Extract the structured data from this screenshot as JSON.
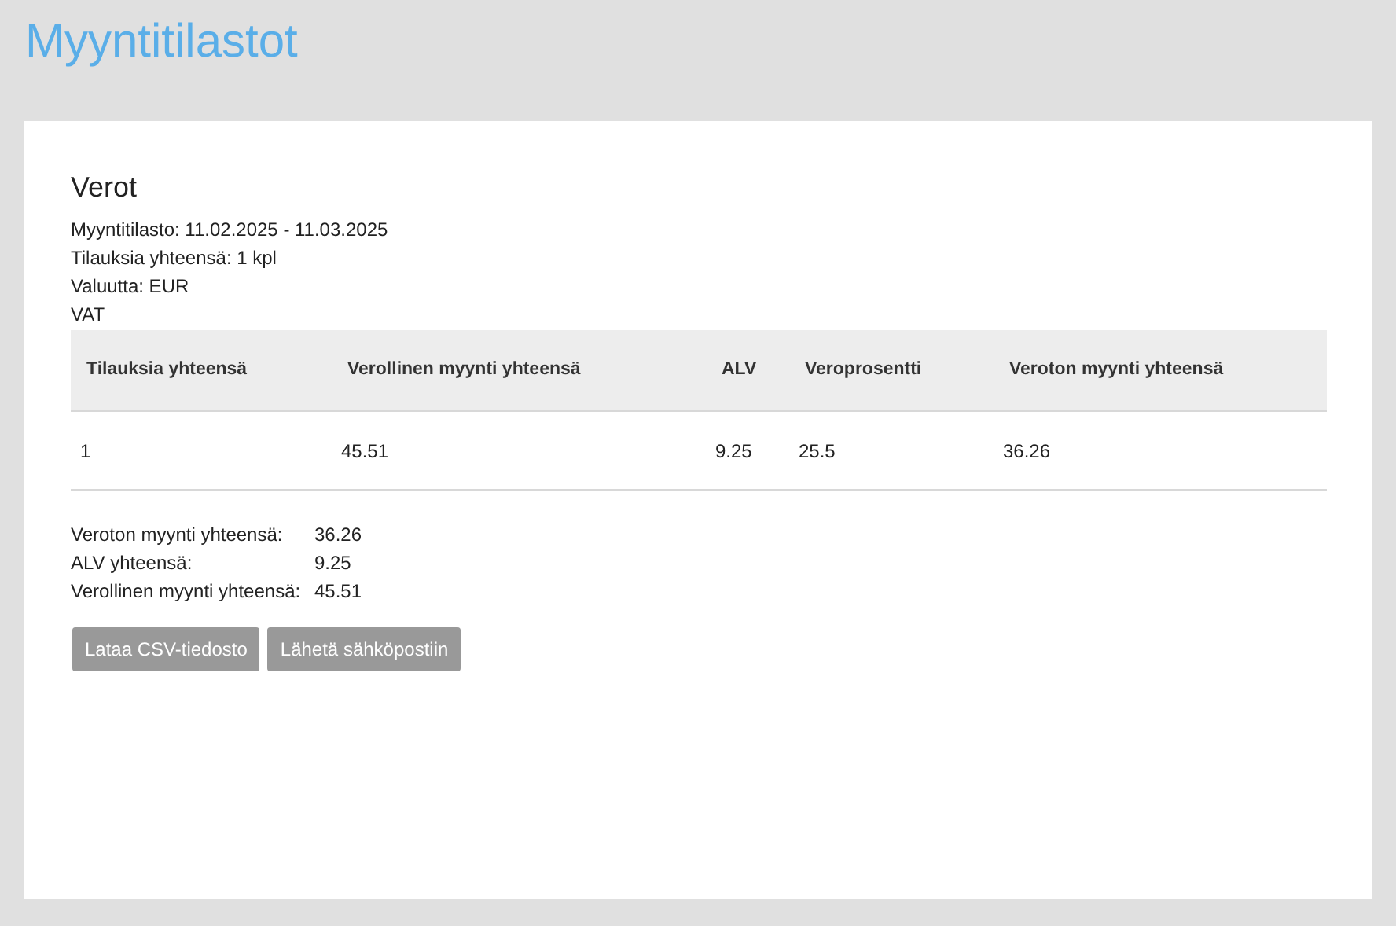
{
  "page_title": "Myyntitilastot",
  "section_title": "Verot",
  "info_lines": [
    "Myyntitilasto: 11.02.2025 - 11.03.2025",
    "Tilauksia yhteensä: 1 kpl",
    "Valuutta: EUR",
    "VAT"
  ],
  "table": {
    "columns": [
      "Tilauksia yhteensä",
      "Verollinen myynti yhteensä",
      "ALV",
      "Veroprosentti",
      "Veroton myynti yhteensä"
    ],
    "rows": [
      [
        "1",
        "45.51",
        "9.25",
        "25.5",
        "36.26"
      ]
    ]
  },
  "totals": [
    {
      "label": "Veroton myynti yhteensä:",
      "value": "36.26"
    },
    {
      "label": "ALV yhteensä:",
      "value": "9.25"
    },
    {
      "label": "Verollinen myynti yhteensä:",
      "value": "45.51"
    }
  ],
  "buttons": [
    "Lataa CSV-tiedosto",
    "Lähetä sähköpostiin"
  ]
}
